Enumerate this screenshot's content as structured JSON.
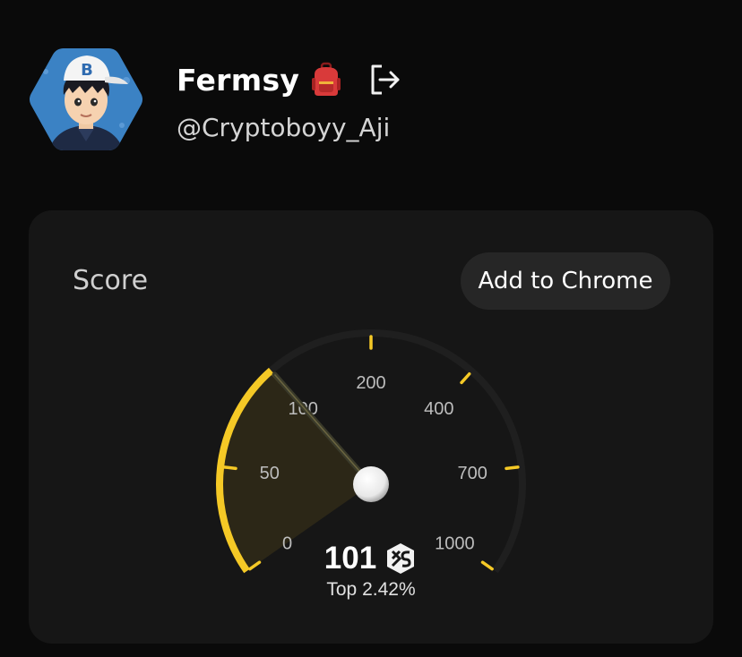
{
  "profile": {
    "name": "Fermsy",
    "handle": "@Cryptoboyy_Aji",
    "avatar_cap_letter": "B",
    "name_emoji_icon": "backpack-icon",
    "logout_icon": "logout-icon"
  },
  "score_card": {
    "title": "Score",
    "add_button_label": "Add to Chrome",
    "gauge": {
      "tick_labels": [
        "0",
        "50",
        "100",
        "200",
        "400",
        "700",
        "1000"
      ],
      "needle_value": 101,
      "accent_color": "#f5c926",
      "track_color": "#1f1f1f"
    },
    "score_value": "101",
    "score_badge_icon": "xs-logo-icon",
    "rank_text": "Top 2.42%"
  }
}
